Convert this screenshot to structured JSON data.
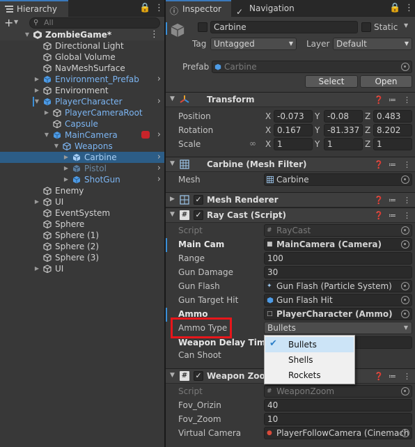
{
  "hierarchy": {
    "tab_label": "Hierarchy",
    "search_placeholder": "All",
    "scene_name": "ZombieGame*",
    "rows": [
      {
        "label": "Directional Light"
      },
      {
        "label": "Global Volume"
      },
      {
        "label": "NavMeshSurface"
      },
      {
        "label": "Environment_Prefab"
      },
      {
        "label": "Environment"
      },
      {
        "label": "PlayerCharacter"
      },
      {
        "label": "PlayerCameraRoot"
      },
      {
        "label": "Capsule"
      },
      {
        "label": "MainCamera"
      },
      {
        "label": "Weapons"
      },
      {
        "label": "Carbine"
      },
      {
        "label": "Pistol"
      },
      {
        "label": "ShotGun"
      },
      {
        "label": "Enemy"
      },
      {
        "label": "UI"
      },
      {
        "label": "EventSystem"
      },
      {
        "label": "Sphere"
      },
      {
        "label": "Sphere (1)"
      },
      {
        "label": "Sphere (2)"
      },
      {
        "label": "Sphere (3)"
      },
      {
        "label": "UI"
      }
    ]
  },
  "inspector": {
    "tab_label": "Inspector",
    "nav_tab_label": "Navigation",
    "object_name": "Carbine",
    "static_label": "Static",
    "tag_label": "Tag",
    "tag_value": "Untagged",
    "layer_label": "Layer",
    "layer_value": "Default",
    "prefab_label": "Prefab",
    "prefab_value": "Carbine",
    "select_button": "Select",
    "open_button": "Open",
    "transform": {
      "title": "Transform",
      "position_label": "Position",
      "rotation_label": "Rotation",
      "scale_label": "Scale",
      "x": "X",
      "y": "Y",
      "z": "Z",
      "position": [
        "-0.073",
        "-0.08",
        "0.483"
      ],
      "rotation": [
        "0.167",
        "-81.337",
        "8.202"
      ],
      "scale": [
        "1",
        "1",
        "1"
      ]
    },
    "mesh_filter": {
      "title": "Carbine (Mesh Filter)",
      "mesh_label": "Mesh",
      "mesh_value": "Carbine"
    },
    "mesh_renderer": {
      "title": "Mesh Renderer"
    },
    "raycast": {
      "title": "Ray Cast (Script)",
      "script_label": "Script",
      "script_value": "RayCast",
      "main_cam_label": "Main Cam",
      "main_cam_value": "MainCamera (Camera)",
      "range_label": "Range",
      "range_value": "100",
      "gun_damage_label": "Gun Damage",
      "gun_damage_value": "30",
      "gun_flash_label": "Gun Flash",
      "gun_flash_value": "Gun Flash (Particle System)",
      "gun_target_label": "Gun Target Hit",
      "gun_target_value": "Gun Flash Hit",
      "ammo_label": "Ammo",
      "ammo_value": "PlayerCharacter (Ammo)",
      "ammo_type_label": "Ammo Type",
      "ammo_type_value": "Bullets",
      "weapon_delay_label": "Weapon Delay Time",
      "can_shoot_label": "Can Shoot"
    },
    "weapon_zoom": {
      "title": "Weapon Zoom",
      "script_label": "Script",
      "script_value": "WeaponZoom",
      "fov_orizin_label": "Fov_Orizin",
      "fov_orizin_value": "40",
      "fov_zoom_label": "Fov_Zoom",
      "fov_zoom_value": "10",
      "virtual_camera_label": "Virtual Camera",
      "virtual_camera_value": "PlayerFollowCamera (Cinemach"
    },
    "dropdown": {
      "options": [
        "Bullets",
        "Shells",
        "Rockets"
      ],
      "selected": "Bullets"
    }
  },
  "colors": {
    "highlight_box": "#e8161b",
    "accent": "#3a79bb",
    "selection": "#2c5d87"
  }
}
